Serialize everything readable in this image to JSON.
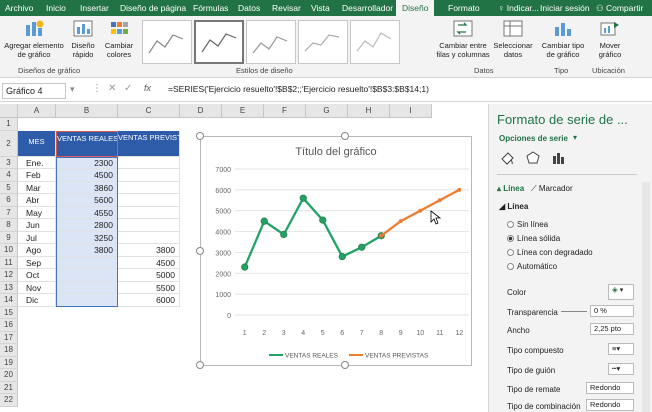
{
  "tabs": [
    "Archivo",
    "Inicio",
    "Insertar",
    "Diseño de página",
    "Fórmulas",
    "Datos",
    "Revisar",
    "Vista",
    "Desarrollador",
    "Diseño",
    "Formato"
  ],
  "tellme": "Indicar...",
  "signin": "Iniciar sesión",
  "share": "Compartir",
  "ribbon": {
    "add_element": "Agregar elemento de gráfico",
    "quick_layout": "Diseño rápido",
    "change_colors": "Cambiar colores",
    "group_layouts": "Diseños de gráfico",
    "group_styles": "Estilos de diseño",
    "switch": "Cambiar entre filas y columnas",
    "select_data": "Seleccionar datos",
    "group_data": "Datos",
    "change_type": "Cambiar tipo de gráfico",
    "group_type": "Tipo",
    "move": "Mover gráfico",
    "group_location": "Ubicación"
  },
  "namebox": "Gráfico 4",
  "fx": "fx",
  "formula": "=SERIES('Ejercicio resuelto'!$B$2;;'Ejercicio resuelto'!$B$3:$B$14;1)",
  "columns": [
    "A",
    "B",
    "C",
    "D",
    "E",
    "F",
    "G",
    "H",
    "I"
  ],
  "rows": [
    "1",
    "2",
    "3",
    "4",
    "5",
    "6",
    "7",
    "8",
    "9",
    "10",
    "11",
    "12",
    "13",
    "14",
    "15",
    "16",
    "17",
    "18",
    "19",
    "20",
    "21",
    "22"
  ],
  "table": {
    "h_mes": "MES",
    "h_reales": "VENTAS REALES",
    "h_previstas": "VENTAS PREVISTAS",
    "months": [
      "Ene.",
      "Feb",
      "Mar",
      "Abr",
      "May",
      "Jun",
      "Jul",
      "Ago",
      "Sep",
      "Oct",
      "Nov",
      "Dic"
    ],
    "reales": [
      "2300",
      "4500",
      "3860",
      "5600",
      "4550",
      "2800",
      "3250",
      "3800",
      "",
      "",
      "",
      ""
    ],
    "previstas": [
      "",
      "",
      "",
      "",
      "",
      "",
      "",
      "3800",
      "4500",
      "5000",
      "5500",
      "6000"
    ]
  },
  "chart_data": {
    "type": "line",
    "title": "Título del gráfico",
    "x": [
      1,
      2,
      3,
      4,
      5,
      6,
      7,
      8,
      9,
      10,
      11,
      12
    ],
    "categories": [
      "1",
      "2",
      "3",
      "4",
      "5",
      "6",
      "7",
      "8",
      "9",
      "10",
      "11",
      "12"
    ],
    "ylim": [
      0,
      7000
    ],
    "yticks": [
      "0",
      "1000",
      "2000",
      "3000",
      "4000",
      "5000",
      "6000",
      "7000"
    ],
    "grid": true,
    "legend": "bottom",
    "series": [
      {
        "name": "VENTAS REALES",
        "color": "#21a366",
        "values": [
          2300,
          4500,
          3860,
          5600,
          4550,
          2800,
          3250,
          3800,
          null,
          null,
          null,
          null
        ]
      },
      {
        "name": "VENTAS PREVISTAS",
        "color": "#ed7d31",
        "values": [
          null,
          null,
          null,
          null,
          null,
          null,
          null,
          3800,
          4500,
          5000,
          5500,
          6000
        ]
      }
    ]
  },
  "pane": {
    "title": "Formato de serie de ...",
    "options": "Opciones de serie",
    "tab_line": "Línea",
    "tab_marker": "Marcador",
    "section": "Línea",
    "radios": [
      "Sin línea",
      "Línea sólida",
      "Línea con degradado",
      "Automático"
    ],
    "color": "Color",
    "transparency": "Transparencia",
    "transparency_val": "0 %",
    "width": "Ancho",
    "width_val": "2,25 pto",
    "compound": "Tipo compuesto",
    "dash": "Tipo de guión",
    "cap": "Tipo de remate",
    "cap_val": "Redondo",
    "join": "Tipo de combinación",
    "join_val": "Redondo"
  }
}
